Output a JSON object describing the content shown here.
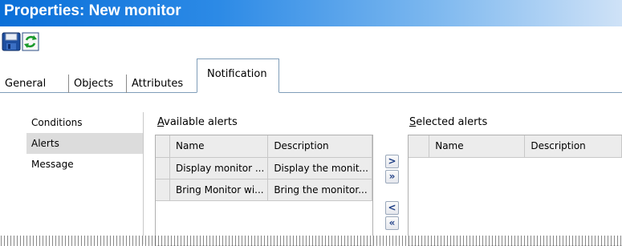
{
  "window": {
    "title": "Properties: New monitor"
  },
  "toolbar": {
    "save_icon": "save-icon",
    "refresh_icon": "refresh-icon"
  },
  "tabs": [
    {
      "label": "General"
    },
    {
      "label": "Objects"
    },
    {
      "label": "Attributes"
    },
    {
      "label": "Notification",
      "active": true
    }
  ],
  "sidebar": {
    "items": [
      {
        "label": "Conditions"
      },
      {
        "label": "Alerts",
        "selected": true
      },
      {
        "label": "Message"
      }
    ]
  },
  "available": {
    "label_accel": "A",
    "label_rest": "vailable alerts",
    "columns": [
      "Name",
      "Description"
    ],
    "rows": [
      [
        "Display monitor ...",
        "Display the monit..."
      ],
      [
        "Bring Monitor wi...",
        "Bring the monitor..."
      ]
    ]
  },
  "selected": {
    "label_accel": "S",
    "label_rest": "elected alerts",
    "columns": [
      "Name",
      "Description"
    ],
    "rows": []
  },
  "move_buttons": {
    "add": ">",
    "add_all": "»",
    "remove": "<",
    "remove_all": "«"
  }
}
